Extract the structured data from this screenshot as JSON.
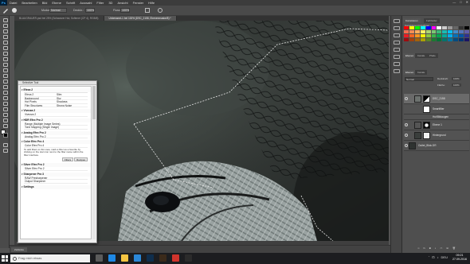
{
  "app": {
    "logo": "Ps",
    "window_controls": [
      "—",
      "□",
      "✕"
    ]
  },
  "menu": [
    "Datei",
    "Bearbeiten",
    "Bild",
    "Ebene",
    "Schrift",
    "Auswahl",
    "Filter",
    "3D",
    "Ansicht",
    "Fenster",
    "Hilfe"
  ],
  "options_bar": {
    "mode_label": "Modus:",
    "mode_value": "Normal",
    "opacity_label": "Deckkr.:",
    "opacity_value": "100%",
    "flow_label": "Fluss:",
    "flow_value": "100%"
  },
  "doc_tabs": [
    {
      "label": "BLAUGRAUER.psd bei 25% (Schwarzer Hut, Softener (CP 4), RGB/8)",
      "active": false
    },
    {
      "label": "Unbenannt-1 bei 100% (DSC_2158, Ebenenmaske/8) *",
      "active": true
    }
  ],
  "status_bar": {
    "zoom": "100%"
  },
  "timeline_tab": "Zeitleiste",
  "right_panel": {
    "top_tabs": [
      "Korrekturen",
      "Farbfelder"
    ],
    "swatches_label": "Korrekturen hinzufügen",
    "mid_tabs": [
      "Ebenen",
      "Kanäle",
      "Pfade"
    ],
    "layers_tabs": [
      "Ebenen",
      "Kanäle"
    ],
    "blend_mode": "Normal",
    "opacity_label": "Deckkraft:",
    "opacity_value": "100%",
    "fill_label": "Fläche:",
    "fill_value": "100%",
    "layers": [
      {
        "name": "DSC_2158",
        "selected": true,
        "has_mask": true
      },
      {
        "name": "Smartfilter",
        "selected": false,
        "has_mask": false
      },
      {
        "name": "Hut/Bildaugen",
        "selected": false,
        "has_mask": false
      },
      {
        "name": "Ebene 1",
        "selected": false,
        "has_mask": true
      },
      {
        "name": "Hintergrund",
        "selected": false,
        "has_mask": true
      },
      {
        "name": "Outlet_Blick.DR",
        "selected": false,
        "has_mask": false
      }
    ],
    "swatch_colors": [
      "#ff0000",
      "#ffff00",
      "#00ff00",
      "#00ffff",
      "#0000ff",
      "#ff00ff",
      "#ffffff",
      "#cccccc",
      "#999999",
      "#666666",
      "#333333",
      "#000000",
      "#f26c4f",
      "#f68e55",
      "#fbaf5c",
      "#fff467",
      "#acd372",
      "#7cc576",
      "#3bb878",
      "#1abbb4",
      "#00bff3",
      "#438cca",
      "#5574b9",
      "#605ca8",
      "#ed1c24",
      "#f26522",
      "#f7941d",
      "#fff200",
      "#8dc63f",
      "#39b54a",
      "#00a651",
      "#00a99d",
      "#00aeef",
      "#0072bc",
      "#0054a6",
      "#2e3192",
      "#9e0b0f",
      "#a0410d",
      "#a36209",
      "#aba000",
      "#598527",
      "#1a7b30",
      "#007236",
      "#00746b",
      "#0076a3",
      "#004b80",
      "#003471",
      "#1b1464"
    ]
  },
  "filter_window": {
    "title": "Selective Tool",
    "sections": [
      {
        "name": "Efexa 2",
        "grid": [
          [
            "Efexa 2",
            "Slim"
          ],
          [
            "Background",
            "Sky"
          ],
          [
            "Hot Pixels",
            "Shadows"
          ],
          [
            "Film Structures",
            "Strong Noise"
          ]
        ]
      },
      {
        "name": "Vivezza 2",
        "rows": [
          "Vivezza 2"
        ]
      },
      {
        "name": "HDR Efex Pro 2",
        "rows": [
          "Range (Multiple Image Series)",
          "Tone Mapping (Single Image)"
        ]
      },
      {
        "name": "Analog Efex Pro 2",
        "rows": [
          "Analog Efex Pro 2"
        ]
      },
      {
        "name": "Color Efex Pro 4",
        "rows": [
          "Color Efex Pro 4"
        ],
        "note": "To add filters to this view, mark a filter as a favorite by clicking on the star icon next to the filter name within the filter interface.",
        "buttons": [
          "Filters",
          "Recipes"
        ]
      },
      {
        "name": "Silver Efex Pro 2",
        "rows": [
          "Silver Efex Pro 2"
        ]
      },
      {
        "name": "Sharpener Pro 3",
        "rows": [
          "RAW Presharpener",
          "Output Sharpener"
        ]
      },
      {
        "name": "Settings",
        "rows": []
      }
    ]
  },
  "taskbar": {
    "search_placeholder": "Frag mich etwas",
    "tray": [
      "ˆ",
      "⊡",
      "♪",
      "DEU"
    ],
    "time": "09:21",
    "date": "27.09.2016",
    "apps": [
      {
        "name": "task-view",
        "color": "#5b5b5b"
      },
      {
        "name": "edge",
        "color": "#1e88e5"
      },
      {
        "name": "explorer",
        "color": "#f5c542"
      },
      {
        "name": "store",
        "color": "#2b88d8"
      },
      {
        "name": "photoshop",
        "color": "#0f2e4d"
      },
      {
        "name": "bridge",
        "color": "#3b2a1a"
      },
      {
        "name": "app-red",
        "color": "#d0342c"
      },
      {
        "name": "app-dark",
        "color": "#2b2b2b"
      }
    ]
  }
}
